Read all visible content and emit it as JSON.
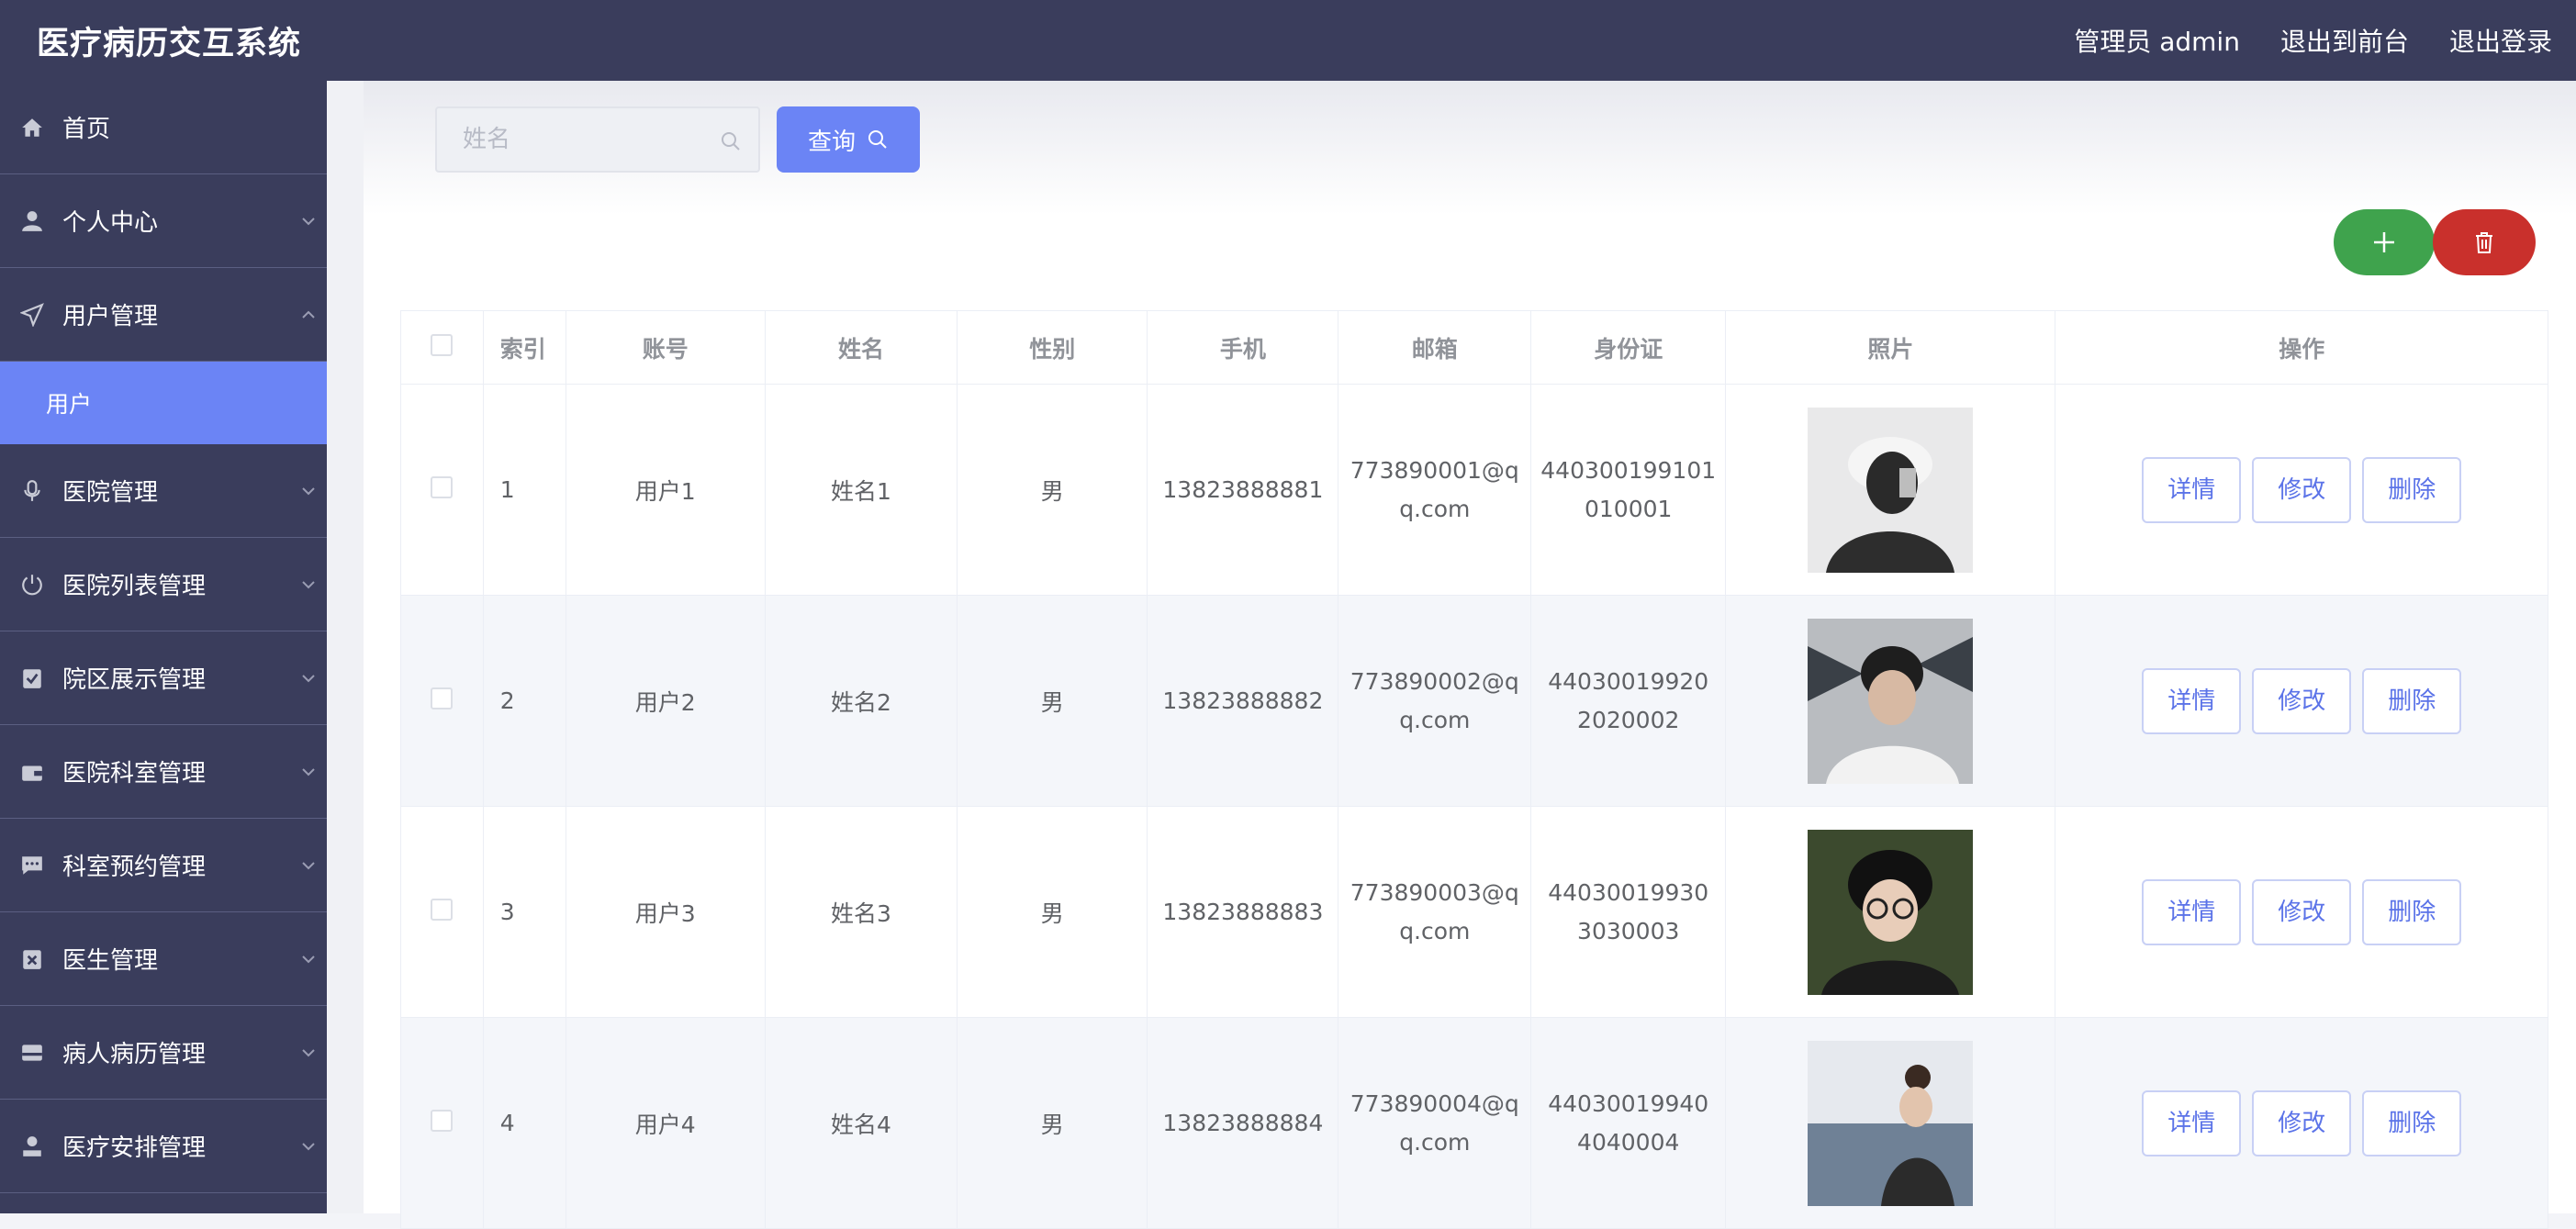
{
  "header": {
    "app_title": "医疗病历交互系统",
    "admin_label": "管理员 admin",
    "to_front_label": "退出到前台",
    "logout_label": "退出登录"
  },
  "sidebar": {
    "items": [
      {
        "label": "首页",
        "icon": "home-icon"
      },
      {
        "label": "个人中心",
        "icon": "user-icon"
      },
      {
        "label": "用户管理",
        "icon": "send-icon",
        "expanded": true
      },
      {
        "label": "医院管理",
        "icon": "microphone-icon"
      },
      {
        "label": "医院列表管理",
        "icon": "power-icon"
      },
      {
        "label": "院区展示管理",
        "icon": "clipboard-check-icon"
      },
      {
        "label": "医院科室管理",
        "icon": "wallet-icon"
      },
      {
        "label": "科室预约管理",
        "icon": "chat-icon"
      },
      {
        "label": "医生管理",
        "icon": "clipboard-x-icon"
      },
      {
        "label": "病人病历管理",
        "icon": "inbox-icon"
      },
      {
        "label": "医疗安排管理",
        "icon": "person-icon"
      }
    ],
    "active_sub": "用户"
  },
  "search": {
    "placeholder": "姓名",
    "value": "",
    "button_label": "查询"
  },
  "table": {
    "headers": [
      "索引",
      "账号",
      "姓名",
      "性别",
      "手机",
      "邮箱",
      "身份证",
      "照片",
      "操作"
    ],
    "rows": [
      {
        "index": "1",
        "account": "用户1",
        "name": "姓名1",
        "gender": "男",
        "phone": "13823888881",
        "email_1": "773890001@q",
        "email_2": "q.com",
        "id_1": "440300199101",
        "id_2": "010001"
      },
      {
        "index": "2",
        "account": "用户2",
        "name": "姓名2",
        "gender": "男",
        "phone": "13823888882",
        "email_1": "773890002@q",
        "email_2": "q.com",
        "id_1": "44030019920",
        "id_2": "2020002"
      },
      {
        "index": "3",
        "account": "用户3",
        "name": "姓名3",
        "gender": "男",
        "phone": "13823888883",
        "email_1": "773890003@q",
        "email_2": "q.com",
        "id_1": "44030019930",
        "id_2": "3030003"
      },
      {
        "index": "4",
        "account": "用户4",
        "name": "姓名4",
        "gender": "男",
        "phone": "13823888884",
        "email_1": "773890004@q",
        "email_2": "q.com",
        "id_1": "44030019940",
        "id_2": "4040004"
      }
    ],
    "actions": {
      "detail": "详情",
      "edit": "修改",
      "delete": "删除"
    }
  },
  "colors": {
    "header_bg": "#3a3d5c",
    "accent": "#6b84f5",
    "add": "#3fa34d",
    "delete": "#c9302c"
  }
}
